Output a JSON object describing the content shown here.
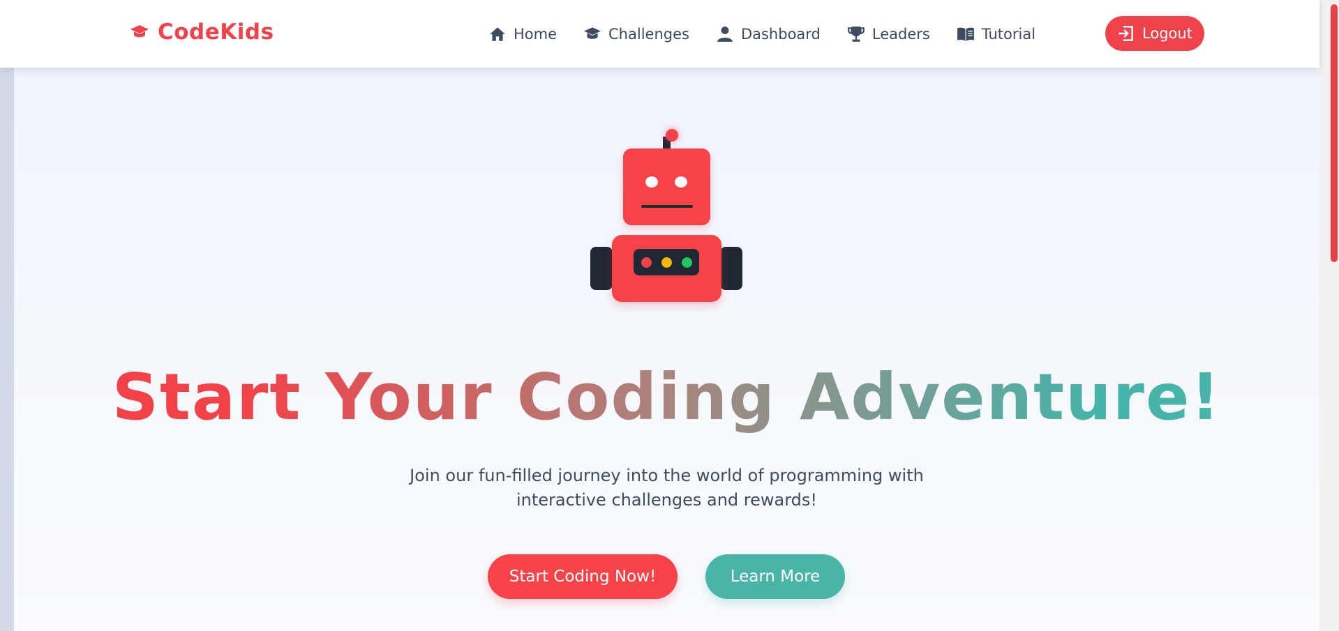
{
  "brand": {
    "name": "CodeKids",
    "icon": "graduation-cap-icon",
    "color": "#f0424b"
  },
  "nav": {
    "items": [
      {
        "label": "Home",
        "icon": "home-icon"
      },
      {
        "label": "Challenges",
        "icon": "graduation-cap-icon"
      },
      {
        "label": "Dashboard",
        "icon": "user-icon"
      },
      {
        "label": "Leaders",
        "icon": "trophy-icon"
      },
      {
        "label": "Tutorial",
        "icon": "book-icon"
      }
    ],
    "logout_label": "Logout",
    "logout_icon": "sign-out-icon"
  },
  "hero": {
    "title": "Start Your Coding Adventure!",
    "subtitle": "Join our fun-filled journey into the world of programming with interactive challenges and rewards!",
    "primary_button": "Start Coding Now!",
    "secondary_button": "Learn More"
  },
  "colors": {
    "primary": "#f0424b",
    "secondary": "#47b3a9",
    "robot_dark": "#1f2733",
    "light_red": "#f0424b",
    "light_yellow": "#f5b800",
    "light_green": "#22c55e"
  }
}
